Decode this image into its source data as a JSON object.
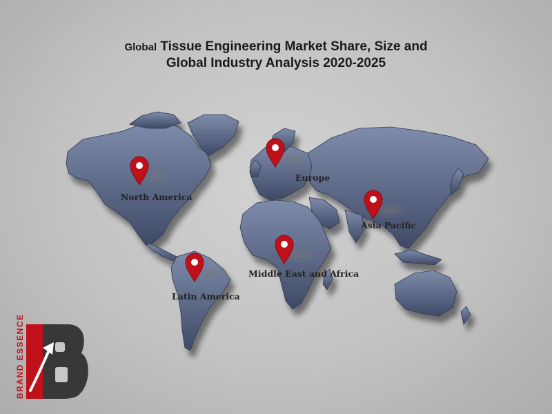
{
  "title": {
    "line1_prefix": "Global",
    "line1_main": " Tissue Engineering Market Share, Size and",
    "line2": "Global Industry Analysis 2020-2025"
  },
  "regions": [
    {
      "id": "north-america",
      "label": "North America"
    },
    {
      "id": "europe",
      "label": "Europe"
    },
    {
      "id": "asia-pacific",
      "label": "Asia Pacific"
    },
    {
      "id": "middle-east-africa",
      "label": "Middle East and Africa"
    },
    {
      "id": "latin-america",
      "label": "Latin America"
    }
  ],
  "colors": {
    "land": "#5f6e8c",
    "land_dark": "#3d4862",
    "pin": "#c0111a",
    "logo_dark": "#333333",
    "logo_red": "#c0111a"
  },
  "logo": {
    "text": "BRAND ESSENCE",
    "letter": "B",
    "icon": "up-arrow-icon"
  }
}
